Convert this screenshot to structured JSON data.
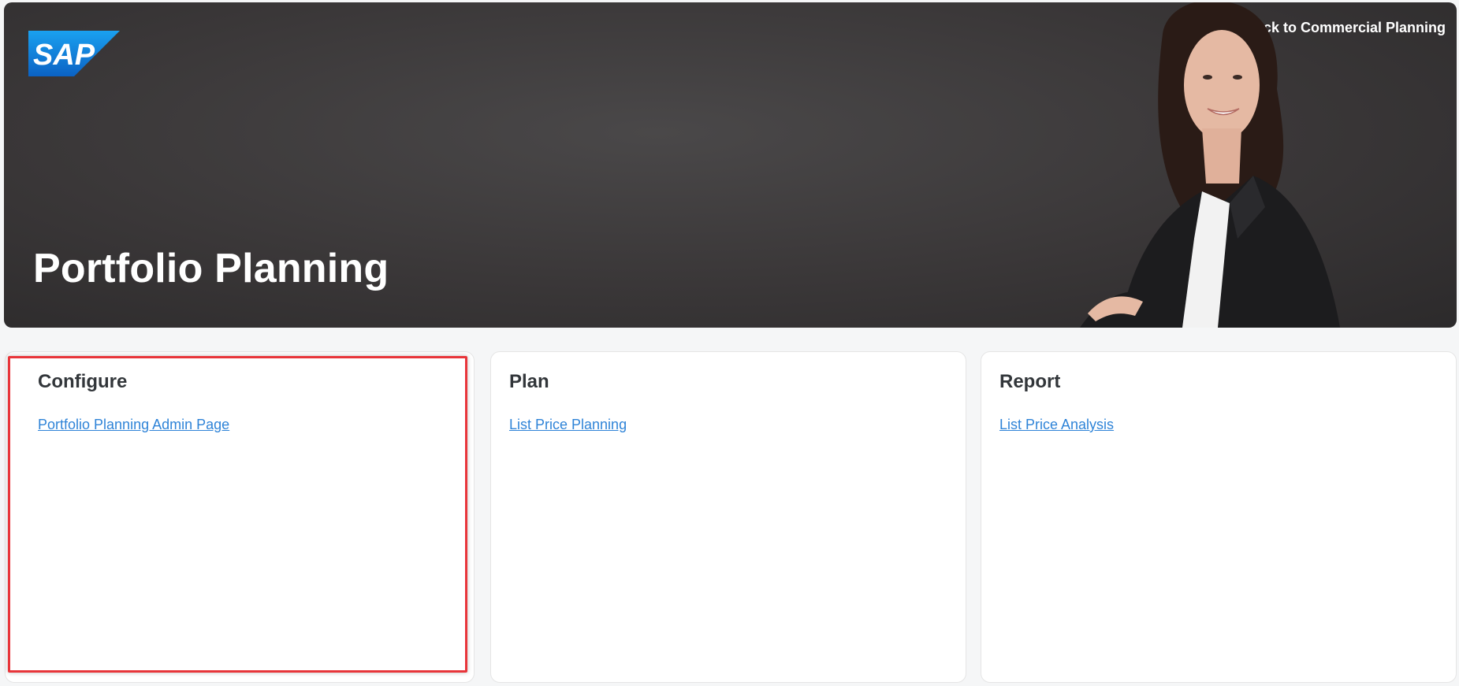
{
  "header": {
    "logo_text": "SAP",
    "back_link_label": "Back to Commercial Planning",
    "page_title": "Portfolio Planning"
  },
  "cards": [
    {
      "title": "Configure",
      "link": "Portfolio Planning Admin Page"
    },
    {
      "title": "Plan",
      "link": "List Price Planning"
    },
    {
      "title": "Report",
      "link": "List Price Analysis"
    }
  ],
  "colors": {
    "banner": "#3a3738",
    "link": "#0a6ed1",
    "highlight": "#e8353a",
    "sap_blue": "#1a8be0"
  },
  "icons": {
    "back": "arrow-left-icon"
  }
}
